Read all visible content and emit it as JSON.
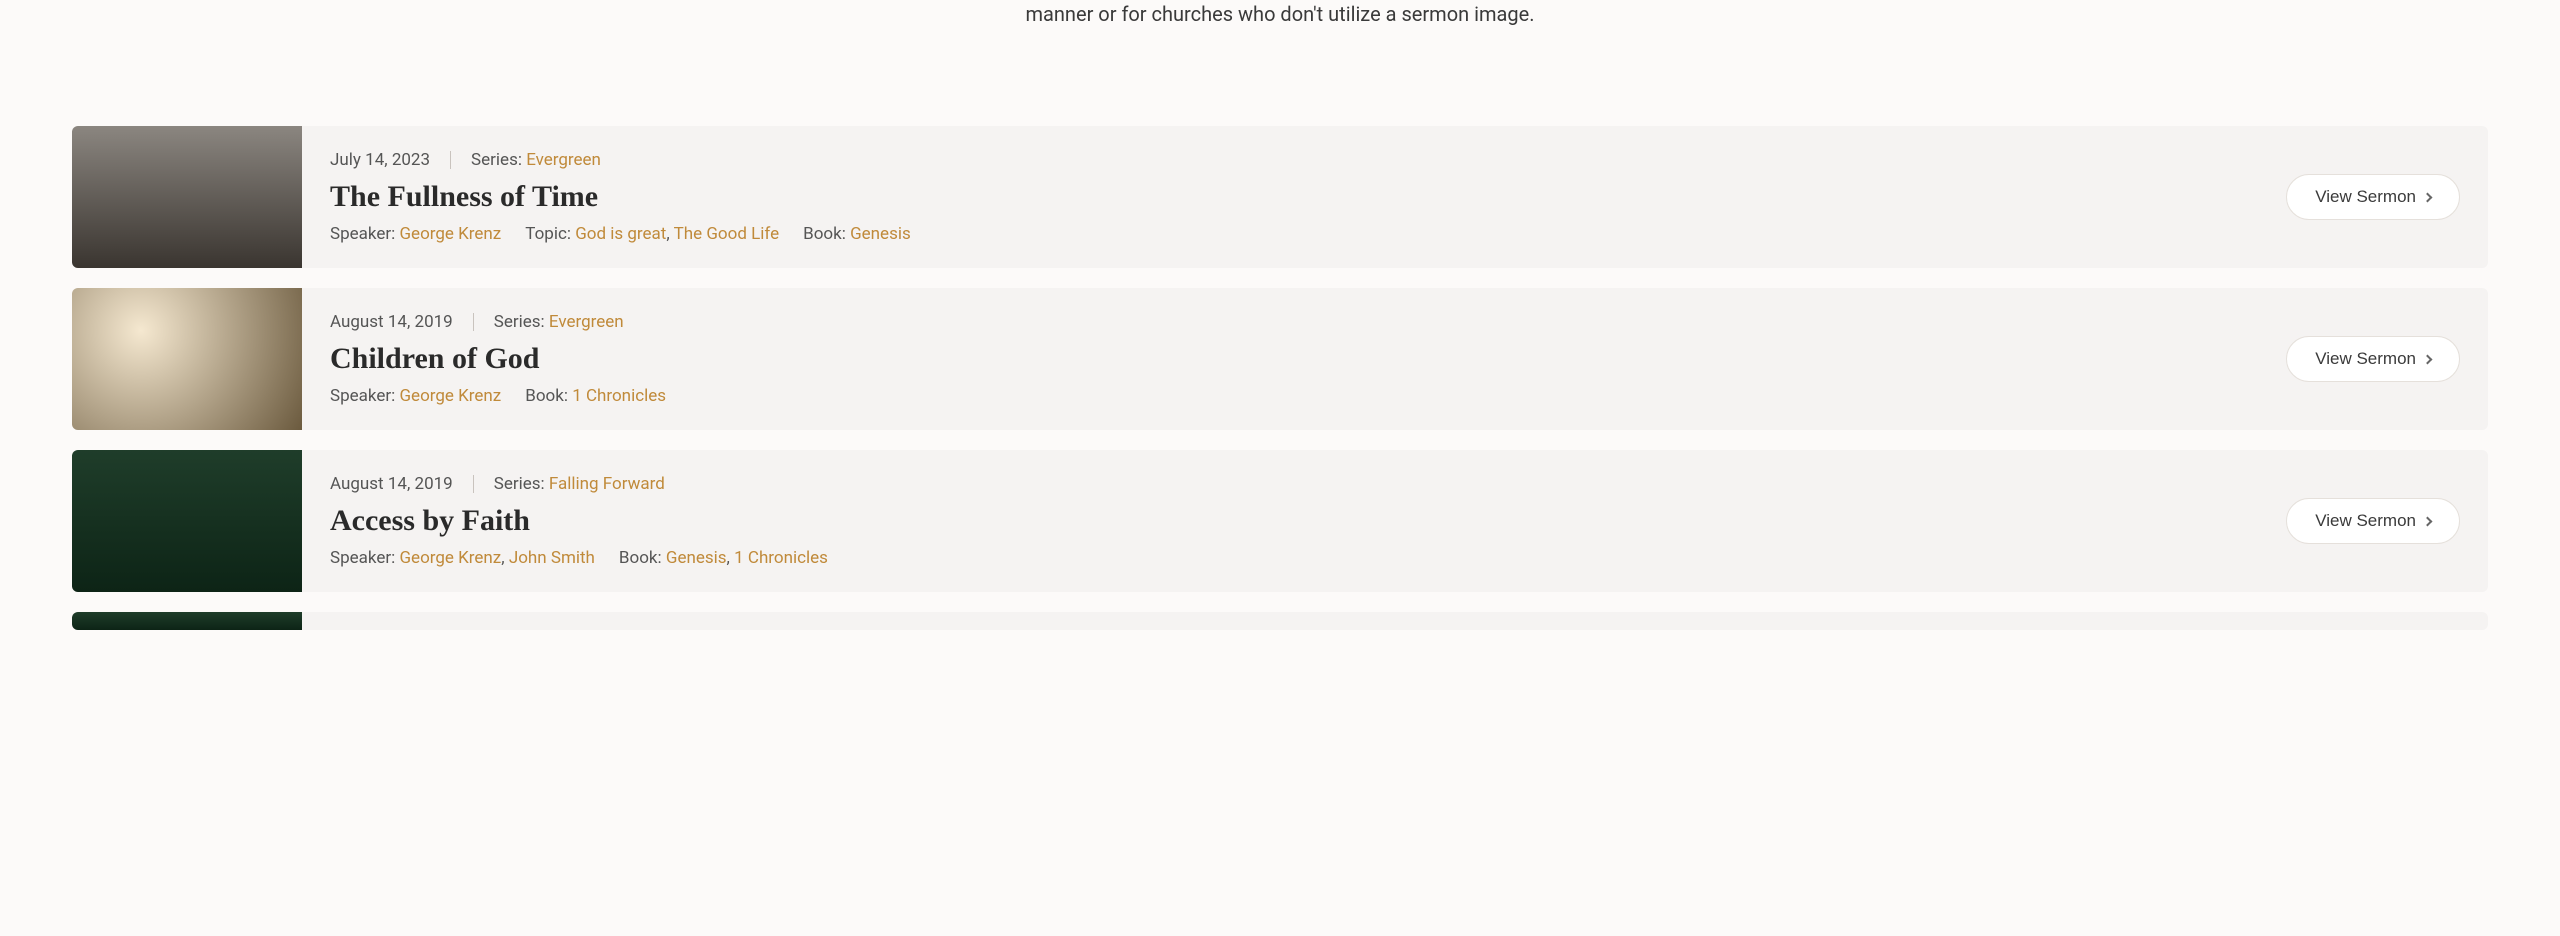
{
  "header_text": "manner or for churches who don't utilize a sermon image.",
  "view_button_label": "View Sermon",
  "labels": {
    "series": "Series:",
    "speaker": "Speaker:",
    "topic": "Topic:",
    "book": "Book:"
  },
  "accent_color": "#c08a3a",
  "sermons": [
    {
      "date": "July 14, 2023",
      "series": [
        "Evergreen"
      ],
      "title": "The Fullness of Time",
      "speakers": [
        "George Krenz"
      ],
      "topics": [
        "God is great",
        "The Good Life"
      ],
      "books": [
        "Genesis"
      ]
    },
    {
      "date": "August 14, 2019",
      "series": [
        "Evergreen"
      ],
      "title": "Children of God",
      "speakers": [
        "George Krenz"
      ],
      "topics": [],
      "books": [
        "1 Chronicles"
      ]
    },
    {
      "date": "August 14, 2019",
      "series": [
        "Falling Forward"
      ],
      "title": "Access by Faith",
      "speakers": [
        "George Krenz",
        "John Smith"
      ],
      "topics": [],
      "books": [
        "Genesis",
        "1 Chronicles"
      ]
    },
    {
      "date": "",
      "series": [],
      "title": "",
      "speakers": [],
      "topics": [],
      "books": []
    }
  ]
}
